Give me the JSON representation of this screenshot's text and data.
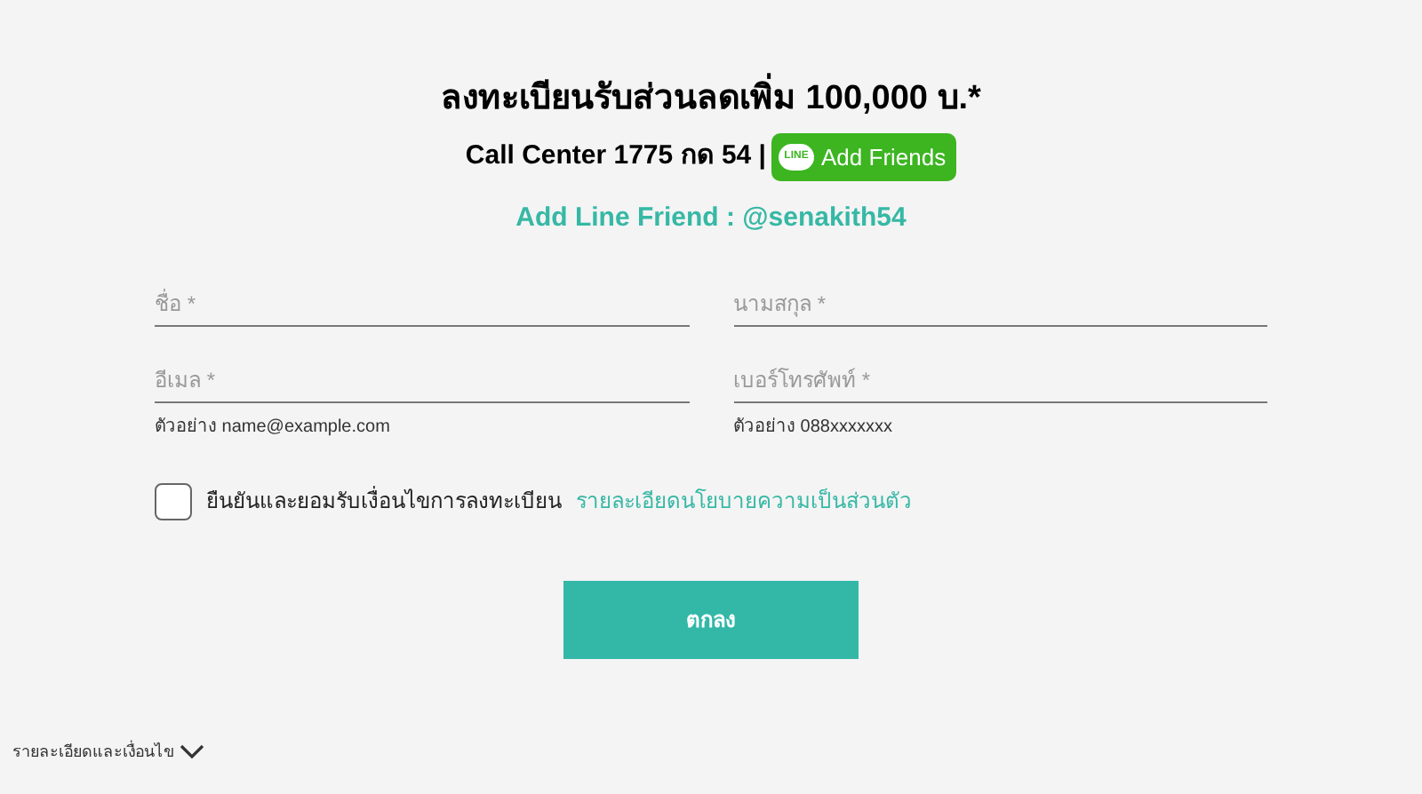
{
  "heading": "ลงทะเบียนรับส่วนลดเพิ่ม 100,000 บ.*",
  "call_center": "Call Center 1775 กด 54 |",
  "line_button": {
    "badge": "LINE",
    "label": "Add Friends"
  },
  "line_friend": "Add Line Friend : @senakith54",
  "fields": [
    {
      "placeholder": "ชื่อ *"
    },
    {
      "placeholder": "นามสกุล *"
    },
    {
      "placeholder": "อีเมล *",
      "hint": "ตัวอย่าง name@example.com"
    },
    {
      "placeholder": "เบอร์โทรศัพท์ *",
      "hint": "ตัวอย่าง 088xxxxxxx"
    }
  ],
  "consent": {
    "checked": false,
    "text": "ยืนยันและยอมรับเงื่อนไขการลงทะเบียน",
    "link": "รายละเอียดนโยบายความเป็นส่วนตัว"
  },
  "submit": "ตกลง",
  "terms": {
    "label": "รายละเอียดและเงื่อนไข",
    "expanded": false
  }
}
